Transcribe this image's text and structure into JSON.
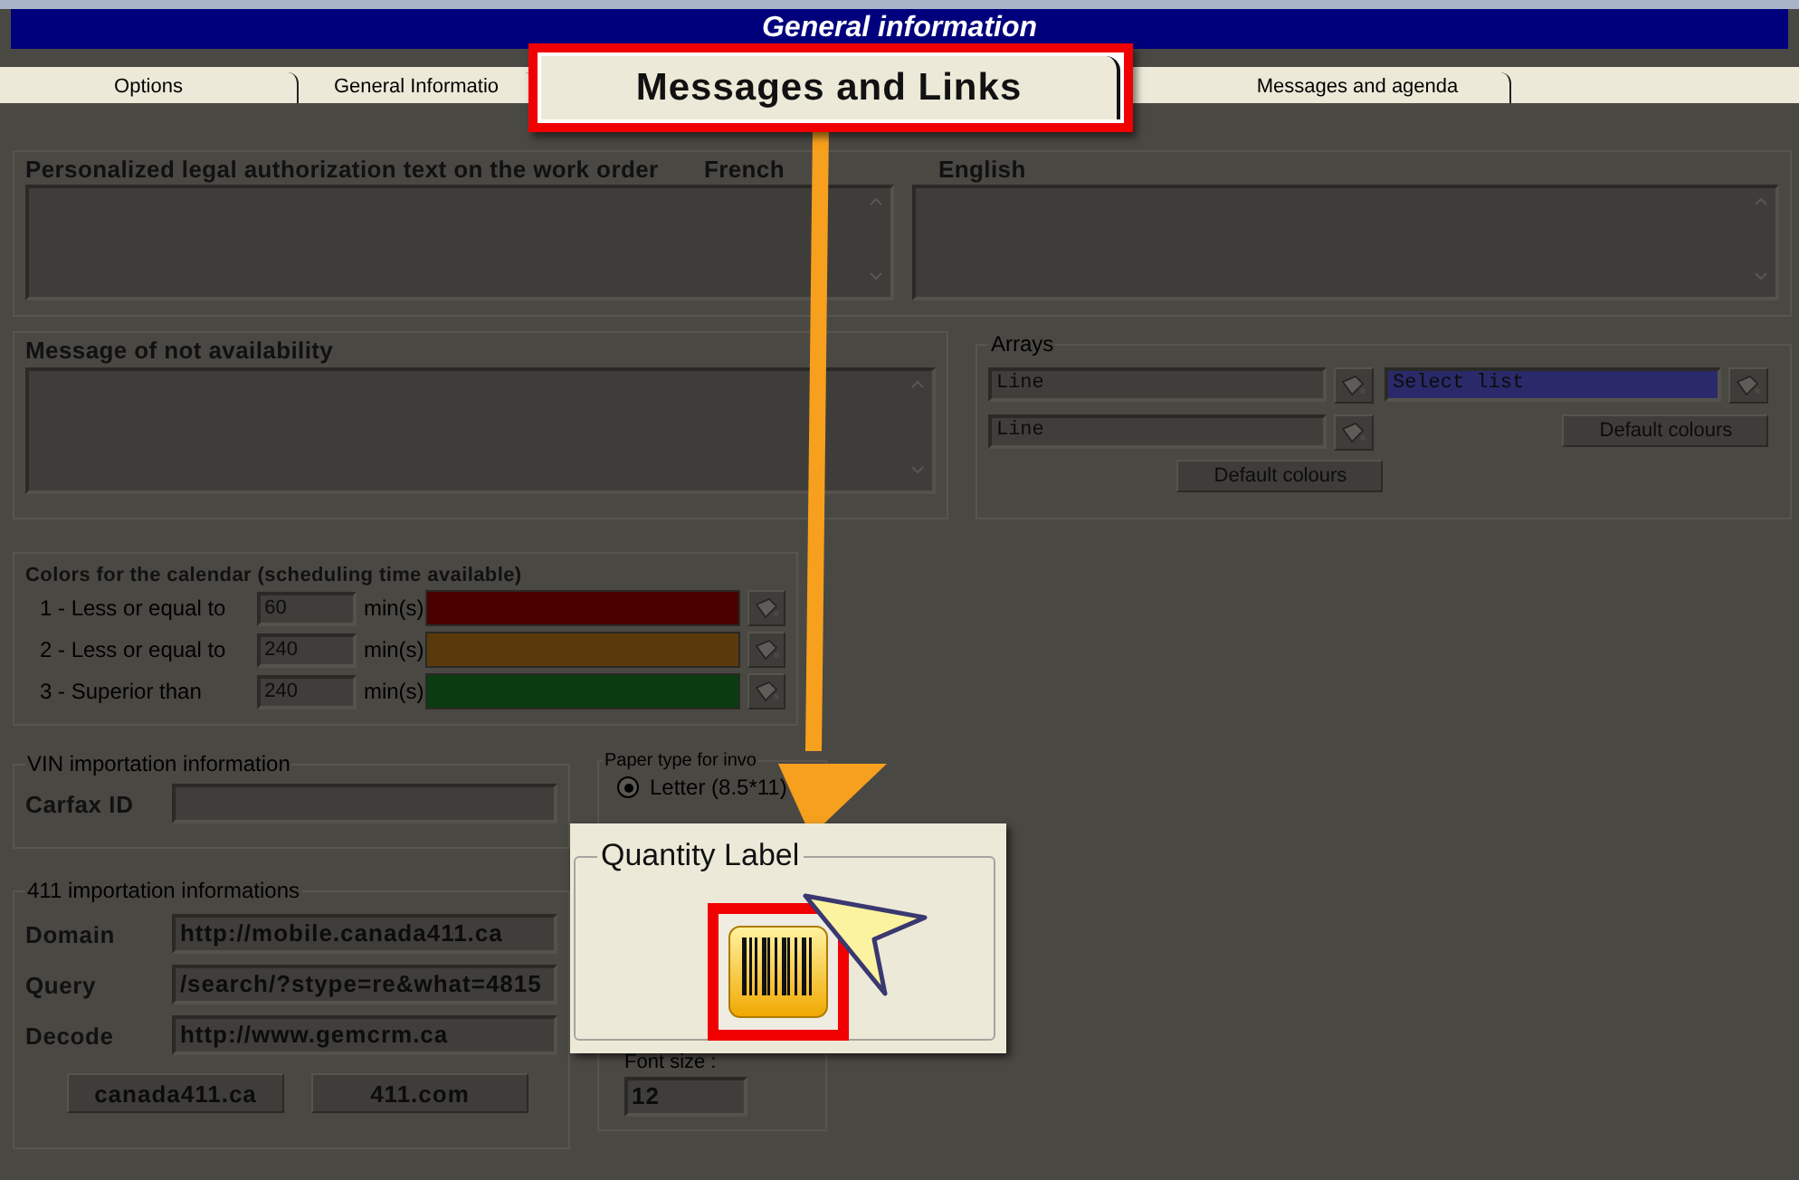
{
  "window": {
    "title": "General information"
  },
  "tabs": [
    {
      "label": "Options",
      "selected": false
    },
    {
      "label": "General Informatio",
      "selected": false
    },
    {
      "label": "Messages and agenda",
      "selected": false
    }
  ],
  "callout_tab": {
    "label": "Messages and Links"
  },
  "legal_text": {
    "title": "Personalized legal authorization text on the work order",
    "languages": [
      "French",
      "English"
    ]
  },
  "not_available": {
    "title": "Message of not availability"
  },
  "arrays": {
    "title": "Arrays",
    "fields": [
      "Line",
      "Line"
    ],
    "select_list": "Select list",
    "buttons": [
      "Default colours",
      "Default colours"
    ]
  },
  "calendar": {
    "title": "Colors for the calendar (scheduling time available)",
    "rows": [
      {
        "label": "1 - Less or equal to",
        "value": "60",
        "unit": "min(s)",
        "color": "#4b0000"
      },
      {
        "label": "2 - Less or equal to",
        "value": "240",
        "unit": "min(s)",
        "color": "#5a3a0c"
      },
      {
        "label": "3 - Superior than",
        "value": "240",
        "unit": "min(s)",
        "color": "#0b3b10"
      }
    ]
  },
  "vin": {
    "title": "VIN importation information",
    "fields": [
      {
        "label": "Carfax ID"
      }
    ]
  },
  "import_411": {
    "title": "411 importation informations",
    "fields": [
      {
        "label": "Domain",
        "value": "http://mobile.canada411.ca"
      },
      {
        "label": "Query",
        "value": "/search/?stype=re&what=4815"
      },
      {
        "label": "Decode",
        "value": "http://www.gemcrm.ca"
      }
    ],
    "buttons": [
      "canada411.ca",
      "411.com"
    ]
  },
  "paper": {
    "title": "Paper type for invo",
    "options": [
      {
        "label": "Letter (8.5*11)",
        "selected": true
      }
    ],
    "font_size_label": "Font size :",
    "font_size": "12"
  },
  "callout": {
    "title": "Quantity Label"
  }
}
